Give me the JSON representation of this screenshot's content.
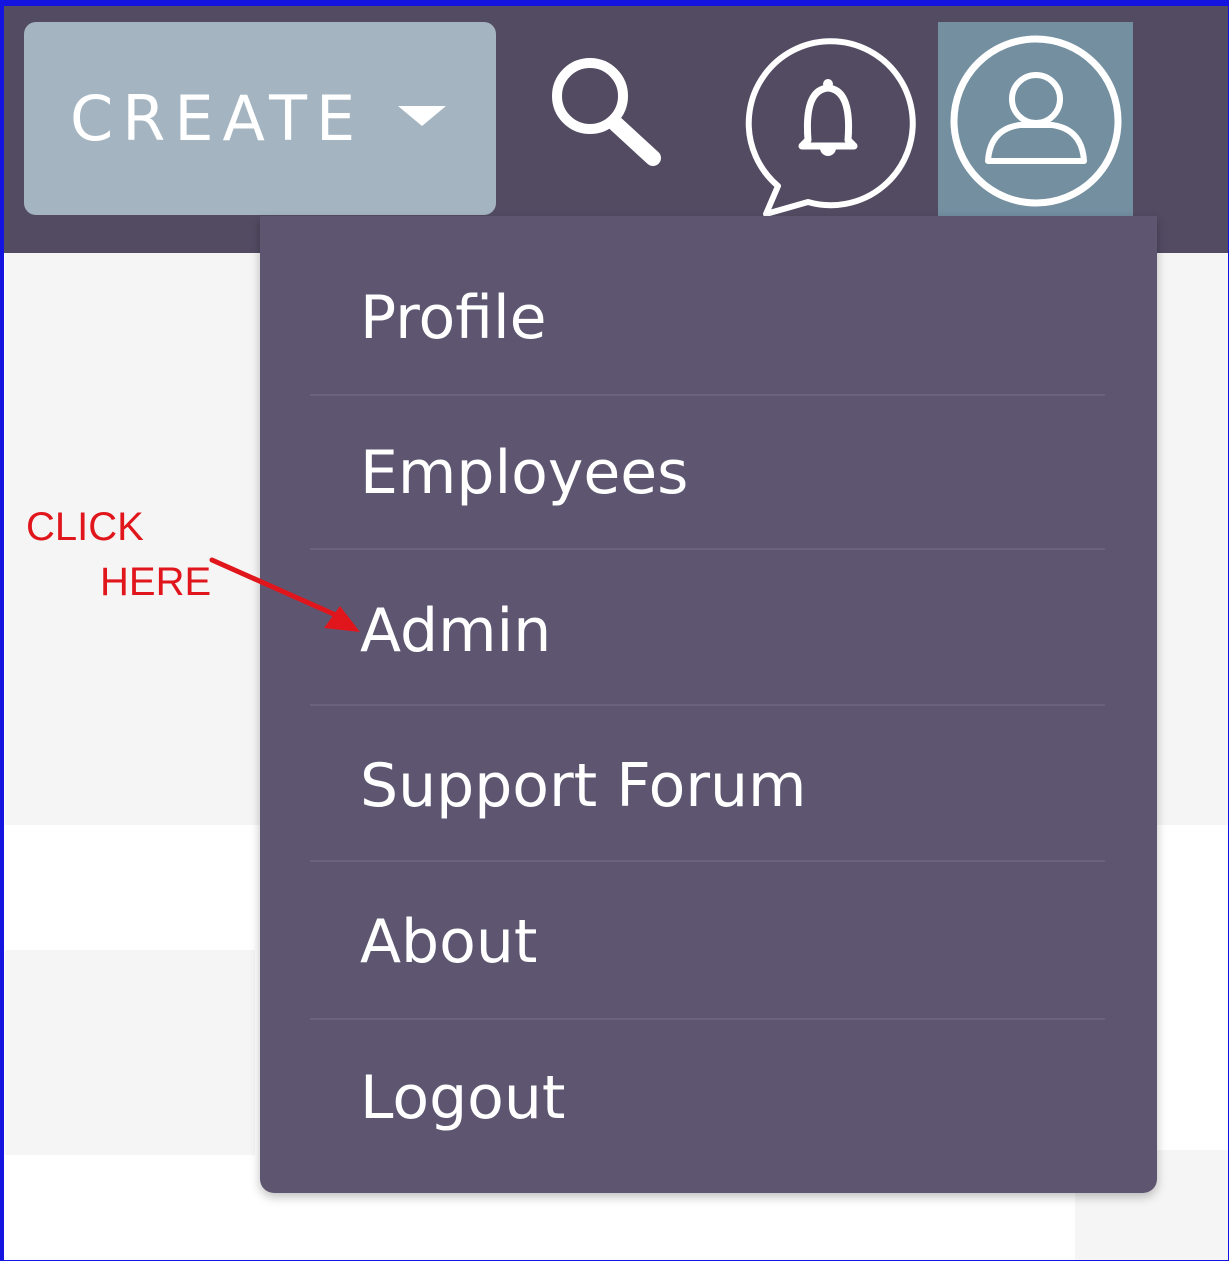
{
  "header": {
    "create_label": "CREATE",
    "icons": {
      "dropdown_caret": "caret-down-icon",
      "search": "search-icon",
      "notifications": "bell-chat-icon",
      "user": "user-avatar-icon"
    },
    "colors": {
      "topbar": "#534b62",
      "create_button": "#a4b5c1",
      "user_button_active": "#738fa0"
    }
  },
  "user_menu": {
    "items": [
      {
        "label": "Profile"
      },
      {
        "label": "Employees"
      },
      {
        "label": "Admin"
      },
      {
        "label": "Support Forum"
      },
      {
        "label": "About"
      },
      {
        "label": "Logout"
      }
    ],
    "background": "#5e5670"
  },
  "annotation": {
    "line1": "CLICK",
    "line2": "HERE",
    "color": "#e0161c"
  }
}
